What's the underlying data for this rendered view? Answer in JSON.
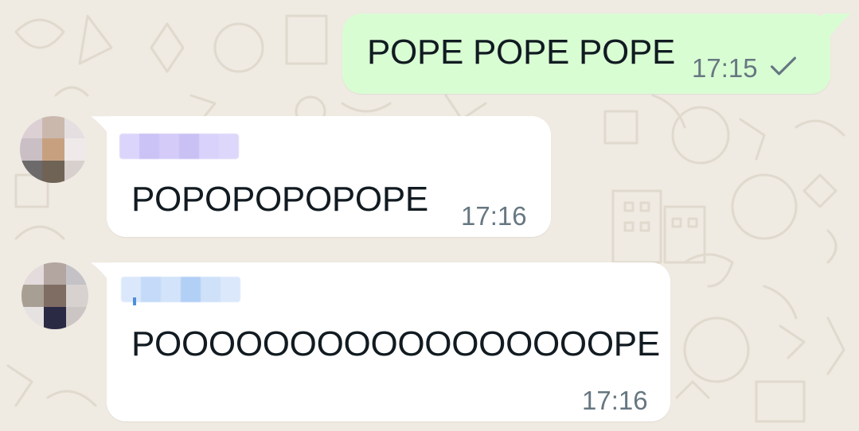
{
  "chat": {
    "messages": [
      {
        "direction": "outgoing",
        "text": "POPE POPE POPE",
        "time": "17:15",
        "status_icon": "single-check-icon"
      },
      {
        "direction": "incoming",
        "sender": "",
        "text": "POPOPOPOPOPE",
        "time": "17:16"
      },
      {
        "direction": "incoming",
        "sender": "",
        "text": "POOOOOOOOOOOOOOOOOPE",
        "time": "17:16"
      }
    ]
  },
  "colors": {
    "wallpaper": "#efeae2",
    "outgoing_bubble": "#d9fdd3",
    "incoming_bubble": "#ffffff",
    "text": "#111b21",
    "meta": "#667781",
    "sender_1_name": "#c9c2f5",
    "sender_2_name": "#b5d2f7"
  }
}
